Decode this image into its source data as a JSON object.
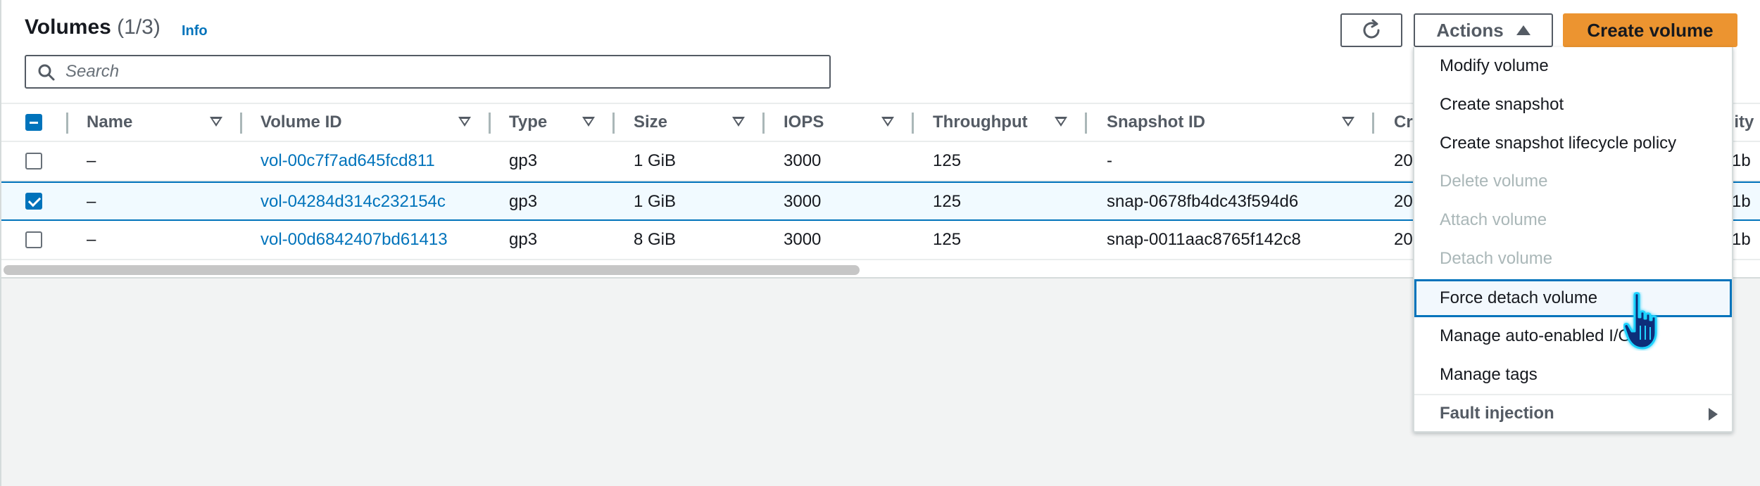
{
  "header": {
    "title": "Volumes",
    "count": "(1/3)",
    "info_label": "Info",
    "search_placeholder": "Search",
    "actions_label": "Actions",
    "create_label": "Create volume"
  },
  "table": {
    "columns": [
      "Name",
      "Volume ID",
      "Type",
      "Size",
      "IOPS",
      "Throughput",
      "Snapshot ID",
      "Cr",
      "ility"
    ],
    "rows": [
      {
        "name": "–",
        "volume_id": "vol-00c7f7ad645fcd811",
        "type": "gp3",
        "size": "1 GiB",
        "iops": "3000",
        "throughput": "125",
        "snapshot_id": "-",
        "created": "20",
        "az": "1b",
        "selected": false
      },
      {
        "name": "–",
        "volume_id": "vol-04284d314c232154c",
        "type": "gp3",
        "size": "1 GiB",
        "iops": "3000",
        "throughput": "125",
        "snapshot_id": "snap-0678fb4dc43f594d6",
        "created": "20",
        "az": "1b",
        "selected": true
      },
      {
        "name": "–",
        "volume_id": "vol-00d6842407bd61413",
        "type": "gp3",
        "size": "8 GiB",
        "iops": "3000",
        "throughput": "125",
        "snapshot_id": "snap-0011aac8765f142c8",
        "created": "20",
        "az": "1b",
        "selected": false
      }
    ]
  },
  "actions_menu": {
    "items": [
      {
        "label": "Modify volume",
        "state": "enabled"
      },
      {
        "label": "Create snapshot",
        "state": "enabled"
      },
      {
        "label": "Create snapshot lifecycle policy",
        "state": "enabled"
      },
      {
        "label": "Delete volume",
        "state": "disabled"
      },
      {
        "label": "Attach volume",
        "state": "disabled"
      },
      {
        "label": "Detach volume",
        "state": "disabled"
      },
      {
        "label": "Force detach volume",
        "state": "highlighted"
      },
      {
        "label": "Manage auto-enabled I/O",
        "state": "enabled"
      },
      {
        "label": "Manage tags",
        "state": "enabled"
      },
      {
        "label": "Fault injection",
        "state": "submenu"
      }
    ]
  },
  "colors": {
    "primary": "#ec9430",
    "link": "#0073bb",
    "disabled_text": "#aab7b8"
  }
}
